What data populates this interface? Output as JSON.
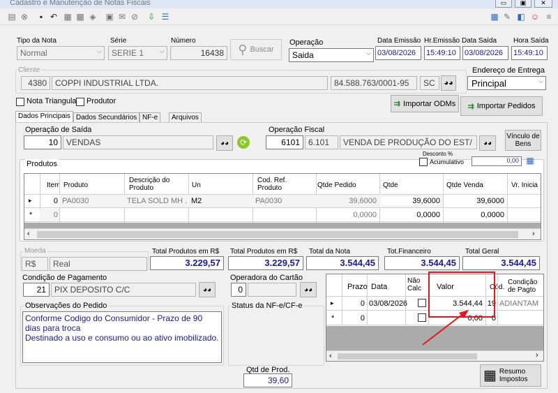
{
  "window": {
    "title": "Cadastro e Manutenção de Notas Fiscais"
  },
  "header": {
    "tipo_nota": {
      "label": "Tipo da Nota",
      "value": "Normal"
    },
    "serie": {
      "label": "Série",
      "value": "SERIE 1"
    },
    "numero": {
      "label": "Número",
      "value": "16438"
    },
    "buscar": "Buscar",
    "operacao": {
      "label": "Operação",
      "value": "Saida"
    },
    "data_emissao": {
      "label": "Data Emissão",
      "value": "03/08/2026"
    },
    "hr_emissao": {
      "label": "Hr.Emissão",
      "value": "15:49:10"
    },
    "data_saida": {
      "label": "Data Saída",
      "value": "03/08/2026"
    },
    "hora_saida": {
      "label": "Hora Saída",
      "value": "15:49:10"
    }
  },
  "cliente": {
    "label": "Cliente",
    "codigo": "4380",
    "nome": "COPPI INDUSTRIAL LTDA.",
    "cnpj": "84.588.763/0001-95",
    "uf": "SC",
    "endereco_label": "Endereço de Entrega",
    "endereco_value": "Principal"
  },
  "flags": {
    "nota_triangular": "Nota Triangular",
    "produtor": "Produtor"
  },
  "actions": {
    "importar_odms": "Importar ODMs",
    "importar_pedidos": "Importar Pedidos"
  },
  "tabs": [
    "Dados Principais",
    "Dados Secundários",
    "NF-e",
    "Arquivos"
  ],
  "operacao_saida": {
    "label": "Operação de Saída",
    "codigo": "10",
    "nome": "VENDAS"
  },
  "operacao_fiscal": {
    "label": "Operação Fiscal",
    "codigo": "6101",
    "cfop": "6.101",
    "nome": "VENDA DE PRODUÇÃO DO EST/"
  },
  "vinculo": "Vínculo de Bens",
  "desconto": {
    "label": "Desconto %",
    "acumulativo": "Acumulativo",
    "value": "0,00"
  },
  "produtos": {
    "legend": "Produtos",
    "columns": [
      "Item",
      "Produto",
      "Descrição do Produto",
      "Un",
      "Cod. Ref. Produto",
      "Qtde Pedido",
      "Qtde",
      "Qtde Venda",
      "Vr. Inicia"
    ],
    "rows": [
      {
        "marker": "▸",
        "item": "0",
        "produto": "PA0030",
        "descricao": "TELA SOLD MH ...",
        "un": "M2",
        "codref": "PA0030",
        "qtde_pedido": "39,6000",
        "qtde": "39,6000",
        "qtde_venda": "39,6000"
      },
      {
        "marker": "*",
        "item": "0",
        "produto": "",
        "descricao": "",
        "un": "",
        "codref": "",
        "qtde_pedido": "0,0000",
        "qtde": "0,0000",
        "qtde_venda": "0,0000"
      }
    ]
  },
  "moeda": {
    "label": "Moeda",
    "codigo": "R$",
    "nome": "Real"
  },
  "totais": {
    "total_produtos_1": {
      "label": "Total Produtos em R$",
      "value": "3.229,57"
    },
    "total_produtos_2": {
      "label": "Total Produtos em R$",
      "value": "3.229,57"
    },
    "total_nota": {
      "label": "Total da Nota",
      "value": "3.544,45"
    },
    "tot_financeiro": {
      "label": "Tot.Financeiro",
      "value": "3.544,45"
    },
    "total_geral": {
      "label": "Total Geral",
      "value": "3.544,45"
    }
  },
  "condicao_pagamento": {
    "label": "Condição de Pagamento",
    "codigo": "21",
    "nome": "PIX DEPOSITO C/C"
  },
  "operadora": {
    "label": "Operadora do Cartão",
    "codigo": "0"
  },
  "status_nfe": {
    "label": "Status da NF-e/CF-e"
  },
  "observacoes": {
    "label": "Observações do Pedido",
    "text": "Conforme Codigo do Consumidor - Prazo de 90 dias para troca\nDestinado a uso e consumo ou ao ativo imobilizado."
  },
  "parcelas": {
    "columns": [
      "Prazo",
      "Data",
      "Não Calc",
      "Valor",
      "Cód.",
      "Condição de Pagto"
    ],
    "rows": [
      {
        "marker": "▸",
        "prazo": "0",
        "data": "03/08/2026",
        "valor": "3.544,44",
        "cod": "19",
        "condicao": "ADIANTAM"
      },
      {
        "marker": "*",
        "prazo": "0",
        "data": "",
        "valor": "0,00",
        "cod": "0",
        "condicao": ""
      }
    ]
  },
  "qtd_prod": {
    "label": "Qtd de Prod.",
    "value": "39,60"
  },
  "resumo": "Resumo Impostos",
  "colors": {
    "highlight": "#e8141a",
    "blue_text": "#1a1a9a",
    "selected_field": "#0078d7"
  }
}
